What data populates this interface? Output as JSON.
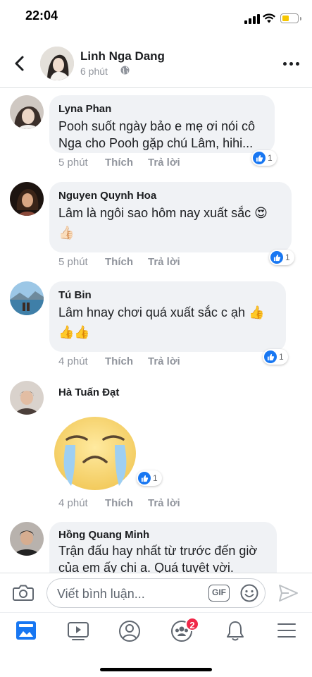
{
  "status_bar": {
    "time": "22:04"
  },
  "post": {
    "author": "Linh Nga Dang",
    "time": "6 phút"
  },
  "comments": [
    {
      "name": "Lyna Phan",
      "lines": [
        "Pooh suốt ngày bảo e mẹ ơi nói cô",
        "Nga cho Pooh gặp chú Lâm, hihi..."
      ],
      "time": "5 phút",
      "like_label": "Thích",
      "reply_label": "Trả lời",
      "reaction_count": "1",
      "reaction": "like"
    },
    {
      "name": "Nguyen Quynh Hoa",
      "lines": [
        "Lâm là ngôi sao hôm nay xuất sắc 😍",
        "👍🏻"
      ],
      "time": "5 phút",
      "like_label": "Thích",
      "reply_label": "Trả lời",
      "reaction_count": "1",
      "reaction": "like"
    },
    {
      "name": "Tú Bin",
      "lines": [
        "Lâm hnay chơi quá xuất sắc c ạh 👍",
        "👍👍"
      ],
      "time": "4 phút",
      "like_label": "Thích",
      "reply_label": "Trả lời",
      "reaction_count": "1",
      "reaction": "like"
    },
    {
      "name": "Hà Tuấn Đạt",
      "sticker": "crying-face-sticker",
      "time": "4 phút",
      "like_label": "Thích",
      "reply_label": "Trả lời",
      "reaction_count": "1",
      "reaction": "like"
    },
    {
      "name": "Hồng Quang Minh",
      "lines": [
        "Trận đấu hay nhất từ trước đến giờ",
        "của em ấy chị ạ. Quá tuyệt vời."
      ]
    }
  ],
  "composer": {
    "placeholder": "Viết bình luận...",
    "gif_label": "GIF"
  },
  "tabbar": {
    "items": [
      "news-feed",
      "watch",
      "profile",
      "groups",
      "notifications",
      "menu"
    ],
    "groups_badge": "2"
  },
  "colors": {
    "accent": "#1877f2",
    "bubble": "#f0f2f5",
    "meta_text": "#90949c",
    "badge": "#f02849"
  }
}
